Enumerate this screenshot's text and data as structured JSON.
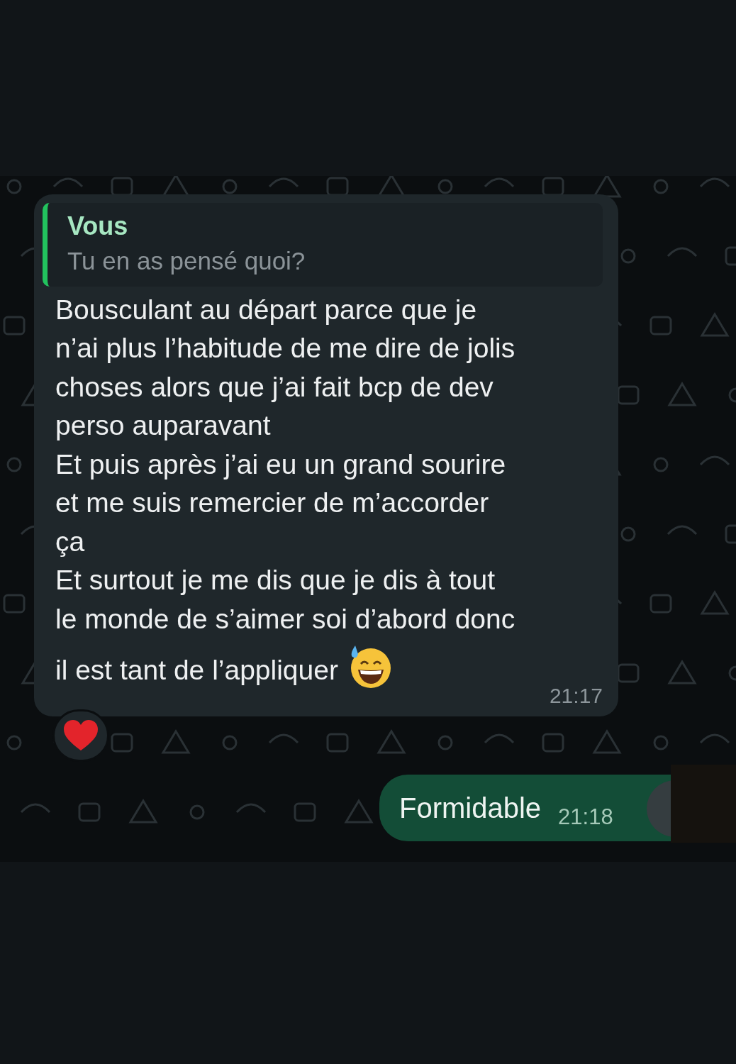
{
  "messages": [
    {
      "kind": "incoming",
      "quote": {
        "author": "Vous",
        "text": "Tu en as pensé quoi?"
      },
      "lines": [
        "Bousculant au départ parce que je",
        "n’ai plus l’habitude de me dire de jolis",
        "choses alors que j’ai fait bcp de dev",
        "perso auparavant",
        "Et puis après j’ai eu un grand sourire",
        "et me suis remercier de m’accorder",
        "ça",
        "Et surtout je me dis que je dis à tout",
        "le monde de s’aimer soi d’abord donc",
        "il est tant de l’appliquer"
      ],
      "time": "21:17",
      "reaction": true
    },
    {
      "kind": "outgoing",
      "lines": [
        "Formidable"
      ],
      "time": "21:18",
      "reaction": false
    }
  ]
}
